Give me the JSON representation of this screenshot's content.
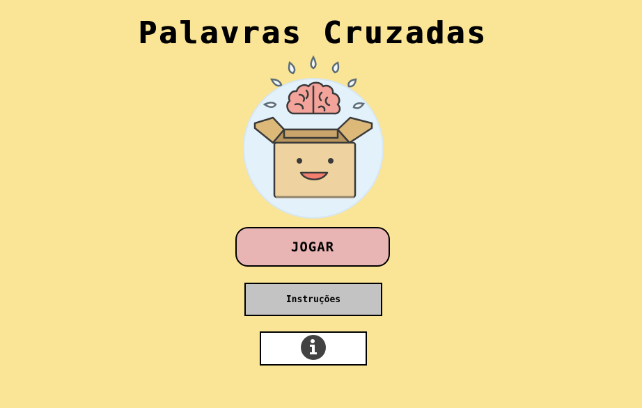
{
  "game": {
    "title": "Palavras Cruzadas"
  },
  "menu": {
    "play_label": "JOGAR",
    "instructions_label": "Instruções",
    "info_icon": "info-icon"
  },
  "colors": {
    "background": "#fae496",
    "play_button": "#e8b4b4",
    "instructions_button": "#c3c3c3",
    "info_button": "#ffffff",
    "logo_circle": "#e3f1fb",
    "brain": "#f4a39a",
    "box": "#eed29f"
  }
}
